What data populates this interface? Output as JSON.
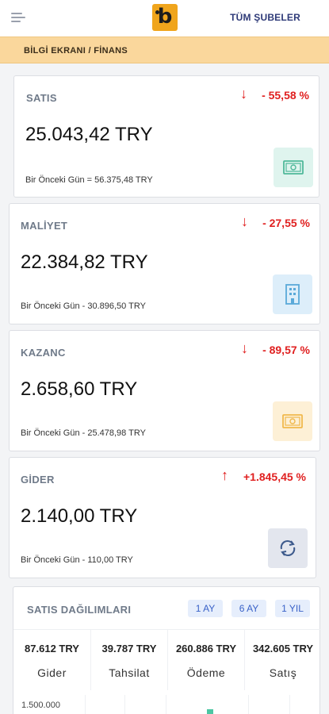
{
  "header": {
    "menu_icon": "hamburger-icon",
    "logo_letter": "b",
    "branches_label": "TÜM ŞUBELER"
  },
  "breadcrumb": "BİLGİ EKRANI / FİNANS",
  "cards": {
    "sales": {
      "label": "SATIS",
      "amount": "25.043,42 TRY",
      "previous": "Bir Önceki Gün = 56.375,48 TRY",
      "change": "- 55,58 %",
      "direction": "down",
      "icon": "money-icon",
      "icon_bg": "#dff4ee",
      "icon_color": "#4fb89a"
    },
    "cost": {
      "label": "MALİYET",
      "amount": "22.384,82 TRY",
      "previous": "Bir Önceki Gün - 30.896,50 TRY",
      "change": "- 27,55 %",
      "direction": "down",
      "icon": "building-icon",
      "icon_bg": "#ddeefa",
      "icon_color": "#5aa9d9"
    },
    "profit": {
      "label": "KAZANC",
      "amount": "2.658,60 TRY",
      "previous": "Bir Önceki Gün - 25.478,98 TRY",
      "change": "- 89,57 %",
      "direction": "down",
      "icon": "money-icon",
      "icon_bg": "#fdf0d6",
      "icon_color": "#f0b84c"
    },
    "expense": {
      "label": "GİDER",
      "amount": "2.140,00 TRY",
      "previous": "Bir Önceki Gün - 110,00 TRY",
      "change": "+1.845,45 %",
      "direction": "up",
      "icon": "refresh-icon",
      "icon_bg": "#e3e6ee",
      "icon_color": "#3d5a8c"
    }
  },
  "arrows": {
    "down": "↓",
    "up": "↑"
  },
  "distribution": {
    "title": "SATIS DAĞILIMLARI",
    "periods": [
      "1 AY",
      "6 AY",
      "1 YIL"
    ],
    "stats": [
      {
        "value": "87.612 TRY",
        "name": "Gider"
      },
      {
        "value": "39.787 TRY",
        "name": "Tahsilat"
      },
      {
        "value": "260.886 TRY",
        "name": "Ödeme"
      },
      {
        "value": "342.605 TRY",
        "name": "Satış"
      }
    ],
    "axis_tick": "1.500.000",
    "accent_color": "#4cc6a3"
  }
}
